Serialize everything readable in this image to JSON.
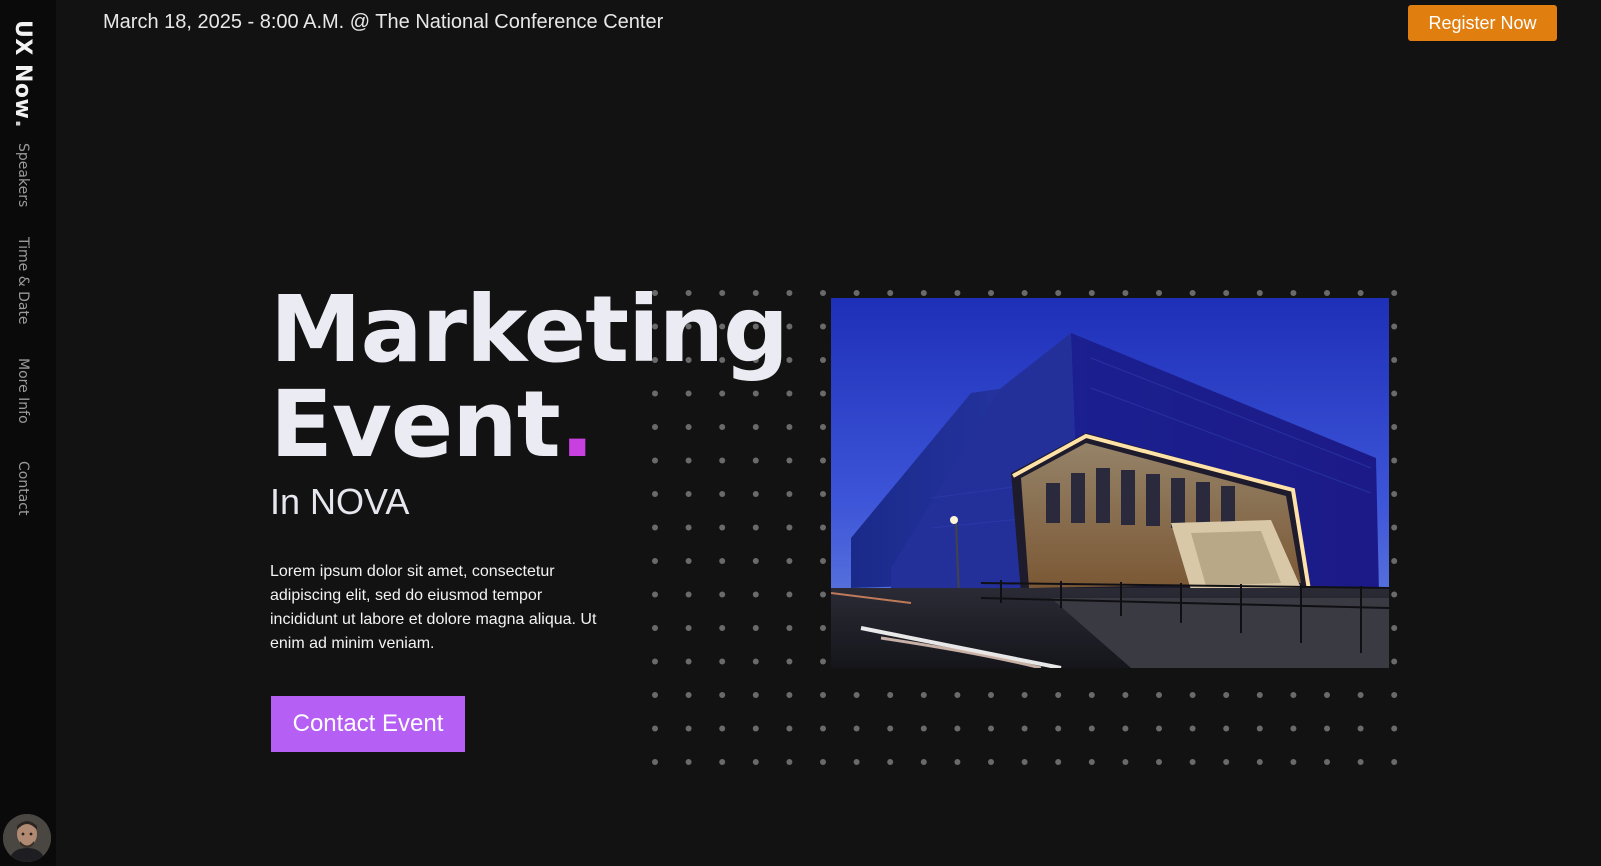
{
  "brand": {
    "name": "UX Now",
    "dot": "."
  },
  "nav": {
    "items": [
      {
        "label": "Speakers"
      },
      {
        "label": "Time & Date"
      },
      {
        "label": "More Info"
      },
      {
        "label": "Contact"
      }
    ]
  },
  "header": {
    "event_info": "March 18, 2025 - 8:00 A.M. @ The National Conference Center",
    "register_label": "Register Now"
  },
  "hero": {
    "title_line1": "Marketing",
    "title_line2": "Event",
    "title_dot": ".",
    "subtitle": "In NOVA",
    "body": "Lorem ipsum dolor sit amet, consectetur adipiscing elit, sed do eiusmod tempor incididunt ut labore et dolore magna aliqua. Ut enim ad minim veniam.",
    "cta_label": "Contact Event"
  },
  "colors": {
    "background": "#121212",
    "sidebar": "#0a0a0a",
    "register_button": "#e07f10",
    "cta_button": "#b65ff5",
    "accent_dot": "#c840e0"
  },
  "icons": {
    "avatar": "user-avatar",
    "image": "conference-center-building-photo"
  }
}
